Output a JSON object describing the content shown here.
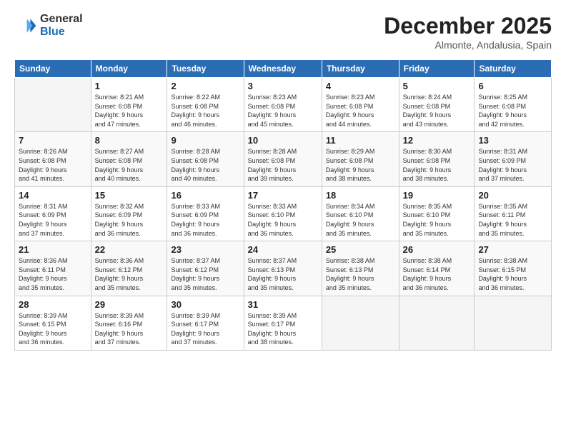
{
  "logo": {
    "general": "General",
    "blue": "Blue"
  },
  "title": {
    "month": "December 2025",
    "location": "Almonte, Andalusia, Spain"
  },
  "weekdays": [
    "Sunday",
    "Monday",
    "Tuesday",
    "Wednesday",
    "Thursday",
    "Friday",
    "Saturday"
  ],
  "weeks": [
    [
      {
        "day": "",
        "info": "",
        "empty": true
      },
      {
        "day": "1",
        "info": "Sunrise: 8:21 AM\nSunset: 6:08 PM\nDaylight: 9 hours\nand 47 minutes.",
        "empty": false
      },
      {
        "day": "2",
        "info": "Sunrise: 8:22 AM\nSunset: 6:08 PM\nDaylight: 9 hours\nand 46 minutes.",
        "empty": false
      },
      {
        "day": "3",
        "info": "Sunrise: 8:23 AM\nSunset: 6:08 PM\nDaylight: 9 hours\nand 45 minutes.",
        "empty": false
      },
      {
        "day": "4",
        "info": "Sunrise: 8:23 AM\nSunset: 6:08 PM\nDaylight: 9 hours\nand 44 minutes.",
        "empty": false
      },
      {
        "day": "5",
        "info": "Sunrise: 8:24 AM\nSunset: 6:08 PM\nDaylight: 9 hours\nand 43 minutes.",
        "empty": false
      },
      {
        "day": "6",
        "info": "Sunrise: 8:25 AM\nSunset: 6:08 PM\nDaylight: 9 hours\nand 42 minutes.",
        "empty": false
      }
    ],
    [
      {
        "day": "7",
        "info": "Sunrise: 8:26 AM\nSunset: 6:08 PM\nDaylight: 9 hours\nand 41 minutes.",
        "empty": false
      },
      {
        "day": "8",
        "info": "Sunrise: 8:27 AM\nSunset: 6:08 PM\nDaylight: 9 hours\nand 40 minutes.",
        "empty": false
      },
      {
        "day": "9",
        "info": "Sunrise: 8:28 AM\nSunset: 6:08 PM\nDaylight: 9 hours\nand 40 minutes.",
        "empty": false
      },
      {
        "day": "10",
        "info": "Sunrise: 8:28 AM\nSunset: 6:08 PM\nDaylight: 9 hours\nand 39 minutes.",
        "empty": false
      },
      {
        "day": "11",
        "info": "Sunrise: 8:29 AM\nSunset: 6:08 PM\nDaylight: 9 hours\nand 38 minutes.",
        "empty": false
      },
      {
        "day": "12",
        "info": "Sunrise: 8:30 AM\nSunset: 6:08 PM\nDaylight: 9 hours\nand 38 minutes.",
        "empty": false
      },
      {
        "day": "13",
        "info": "Sunrise: 8:31 AM\nSunset: 6:09 PM\nDaylight: 9 hours\nand 37 minutes.",
        "empty": false
      }
    ],
    [
      {
        "day": "14",
        "info": "Sunrise: 8:31 AM\nSunset: 6:09 PM\nDaylight: 9 hours\nand 37 minutes.",
        "empty": false
      },
      {
        "day": "15",
        "info": "Sunrise: 8:32 AM\nSunset: 6:09 PM\nDaylight: 9 hours\nand 36 minutes.",
        "empty": false
      },
      {
        "day": "16",
        "info": "Sunrise: 8:33 AM\nSunset: 6:09 PM\nDaylight: 9 hours\nand 36 minutes.",
        "empty": false
      },
      {
        "day": "17",
        "info": "Sunrise: 8:33 AM\nSunset: 6:10 PM\nDaylight: 9 hours\nand 36 minutes.",
        "empty": false
      },
      {
        "day": "18",
        "info": "Sunrise: 8:34 AM\nSunset: 6:10 PM\nDaylight: 9 hours\nand 35 minutes.",
        "empty": false
      },
      {
        "day": "19",
        "info": "Sunrise: 8:35 AM\nSunset: 6:10 PM\nDaylight: 9 hours\nand 35 minutes.",
        "empty": false
      },
      {
        "day": "20",
        "info": "Sunrise: 8:35 AM\nSunset: 6:11 PM\nDaylight: 9 hours\nand 35 minutes.",
        "empty": false
      }
    ],
    [
      {
        "day": "21",
        "info": "Sunrise: 8:36 AM\nSunset: 6:11 PM\nDaylight: 9 hours\nand 35 minutes.",
        "empty": false
      },
      {
        "day": "22",
        "info": "Sunrise: 8:36 AM\nSunset: 6:12 PM\nDaylight: 9 hours\nand 35 minutes.",
        "empty": false
      },
      {
        "day": "23",
        "info": "Sunrise: 8:37 AM\nSunset: 6:12 PM\nDaylight: 9 hours\nand 35 minutes.",
        "empty": false
      },
      {
        "day": "24",
        "info": "Sunrise: 8:37 AM\nSunset: 6:13 PM\nDaylight: 9 hours\nand 35 minutes.",
        "empty": false
      },
      {
        "day": "25",
        "info": "Sunrise: 8:38 AM\nSunset: 6:13 PM\nDaylight: 9 hours\nand 35 minutes.",
        "empty": false
      },
      {
        "day": "26",
        "info": "Sunrise: 8:38 AM\nSunset: 6:14 PM\nDaylight: 9 hours\nand 36 minutes.",
        "empty": false
      },
      {
        "day": "27",
        "info": "Sunrise: 8:38 AM\nSunset: 6:15 PM\nDaylight: 9 hours\nand 36 minutes.",
        "empty": false
      }
    ],
    [
      {
        "day": "28",
        "info": "Sunrise: 8:39 AM\nSunset: 6:15 PM\nDaylight: 9 hours\nand 36 minutes.",
        "empty": false
      },
      {
        "day": "29",
        "info": "Sunrise: 8:39 AM\nSunset: 6:16 PM\nDaylight: 9 hours\nand 37 minutes.",
        "empty": false
      },
      {
        "day": "30",
        "info": "Sunrise: 8:39 AM\nSunset: 6:17 PM\nDaylight: 9 hours\nand 37 minutes.",
        "empty": false
      },
      {
        "day": "31",
        "info": "Sunrise: 8:39 AM\nSunset: 6:17 PM\nDaylight: 9 hours\nand 38 minutes.",
        "empty": false
      },
      {
        "day": "",
        "info": "",
        "empty": true
      },
      {
        "day": "",
        "info": "",
        "empty": true
      },
      {
        "day": "",
        "info": "",
        "empty": true
      }
    ]
  ]
}
